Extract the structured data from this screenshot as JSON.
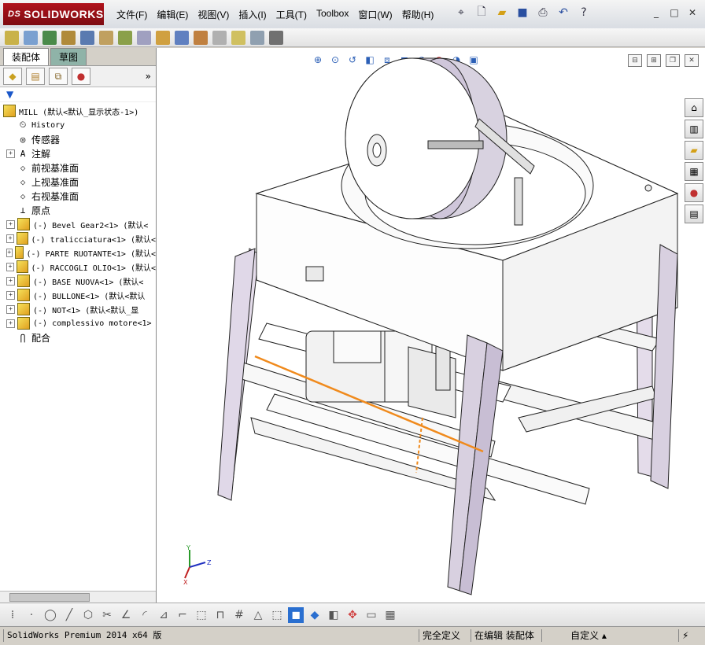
{
  "app": {
    "logo_text": "SOLIDWORKS",
    "logo_prefix": "DS"
  },
  "menu": [
    "文件(F)",
    "编辑(E)",
    "视图(V)",
    "插入(I)",
    "工具(T)",
    "Toolbox",
    "窗口(W)",
    "帮助(H)"
  ],
  "panel": {
    "tabs": [
      "装配体",
      "草图"
    ],
    "active_tab": 0,
    "root_label": "MILL  (默认<默认_显示状态-1>)",
    "tree": [
      {
        "label": "History",
        "icon": "history-icon",
        "expand": false
      },
      {
        "label": "传感器",
        "icon": "sensor-icon",
        "expand": false
      },
      {
        "label": "注解",
        "icon": "annotation-icon",
        "expand": true
      },
      {
        "label": "前视基准面",
        "icon": "plane-icon",
        "expand": false
      },
      {
        "label": "上视基准面",
        "icon": "plane-icon",
        "expand": false
      },
      {
        "label": "右视基准面",
        "icon": "plane-icon",
        "expand": false
      },
      {
        "label": "原点",
        "icon": "origin-icon",
        "expand": false
      },
      {
        "label": "(-) Bevel Gear2<1> (默认<",
        "icon": "part-icon",
        "expand": true
      },
      {
        "label": "(-) tralicciatura<1> (默认<",
        "icon": "part-icon",
        "expand": true
      },
      {
        "label": "(-) PARTE RUOTANTE<1> (默认<",
        "icon": "part-icon",
        "expand": true
      },
      {
        "label": "(-) RACCOGLI OLIO<1> (默认<",
        "icon": "part-icon",
        "expand": true
      },
      {
        "label": "(-) BASE NUOVA<1> (默认<",
        "icon": "part-icon",
        "expand": true
      },
      {
        "label": "(-) BULLONE<1> (默认<默认",
        "icon": "part-icon",
        "expand": true
      },
      {
        "label": "(-) NOT<1> (默认<默认_显",
        "icon": "part-icon",
        "expand": true
      },
      {
        "label": "(-) complessivo motore<1>",
        "icon": "part-icon",
        "expand": true
      },
      {
        "label": "配合",
        "icon": "mates-icon",
        "expand": false
      }
    ]
  },
  "status": {
    "product": "SolidWorks Premium 2014 x64 版",
    "definition": "完全定义",
    "editing": "在编辑 装配体",
    "units": "自定义"
  },
  "colors": {
    "logo_red": "#9b0f17",
    "frame_purple": "#d8d0e0",
    "highlight_orange": "#f08a1c"
  }
}
